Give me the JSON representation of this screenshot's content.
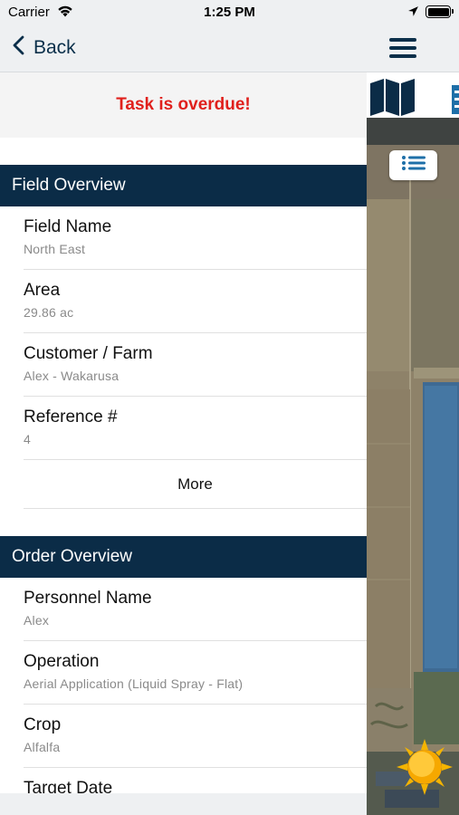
{
  "status_bar": {
    "carrier": "Carrier",
    "time": "1:25 PM"
  },
  "nav": {
    "back_label": "Back"
  },
  "banner": {
    "text": "Task is overdue!"
  },
  "field_overview": {
    "title": "Field Overview",
    "rows": [
      {
        "label": "Field Name",
        "value": "North East"
      },
      {
        "label": "Area",
        "value": "29.86 ac"
      },
      {
        "label": "Customer / Farm",
        "value": "Alex - Wakarusa"
      },
      {
        "label": "Reference #",
        "value": "4"
      }
    ],
    "more_label": "More"
  },
  "order_overview": {
    "title": "Order Overview",
    "rows": [
      {
        "label": "Personnel Name",
        "value": "Alex"
      },
      {
        "label": "Operation",
        "value": "Aerial Application (Liquid Spray - Flat)"
      },
      {
        "label": "Crop",
        "value": "Alfalfa"
      },
      {
        "label": "Target Date",
        "value": ""
      }
    ]
  },
  "icons": {
    "back": "chevron-left-icon",
    "menu": "hamburger-menu-icon",
    "map_tab": "map-icon",
    "list_tab": "list-icon",
    "layers": "list-icon",
    "weather": "sun-icon"
  },
  "colors": {
    "section_header": "#0b2c47",
    "overdue_text": "#e0201c",
    "nav_tint": "#0a2f4a"
  }
}
